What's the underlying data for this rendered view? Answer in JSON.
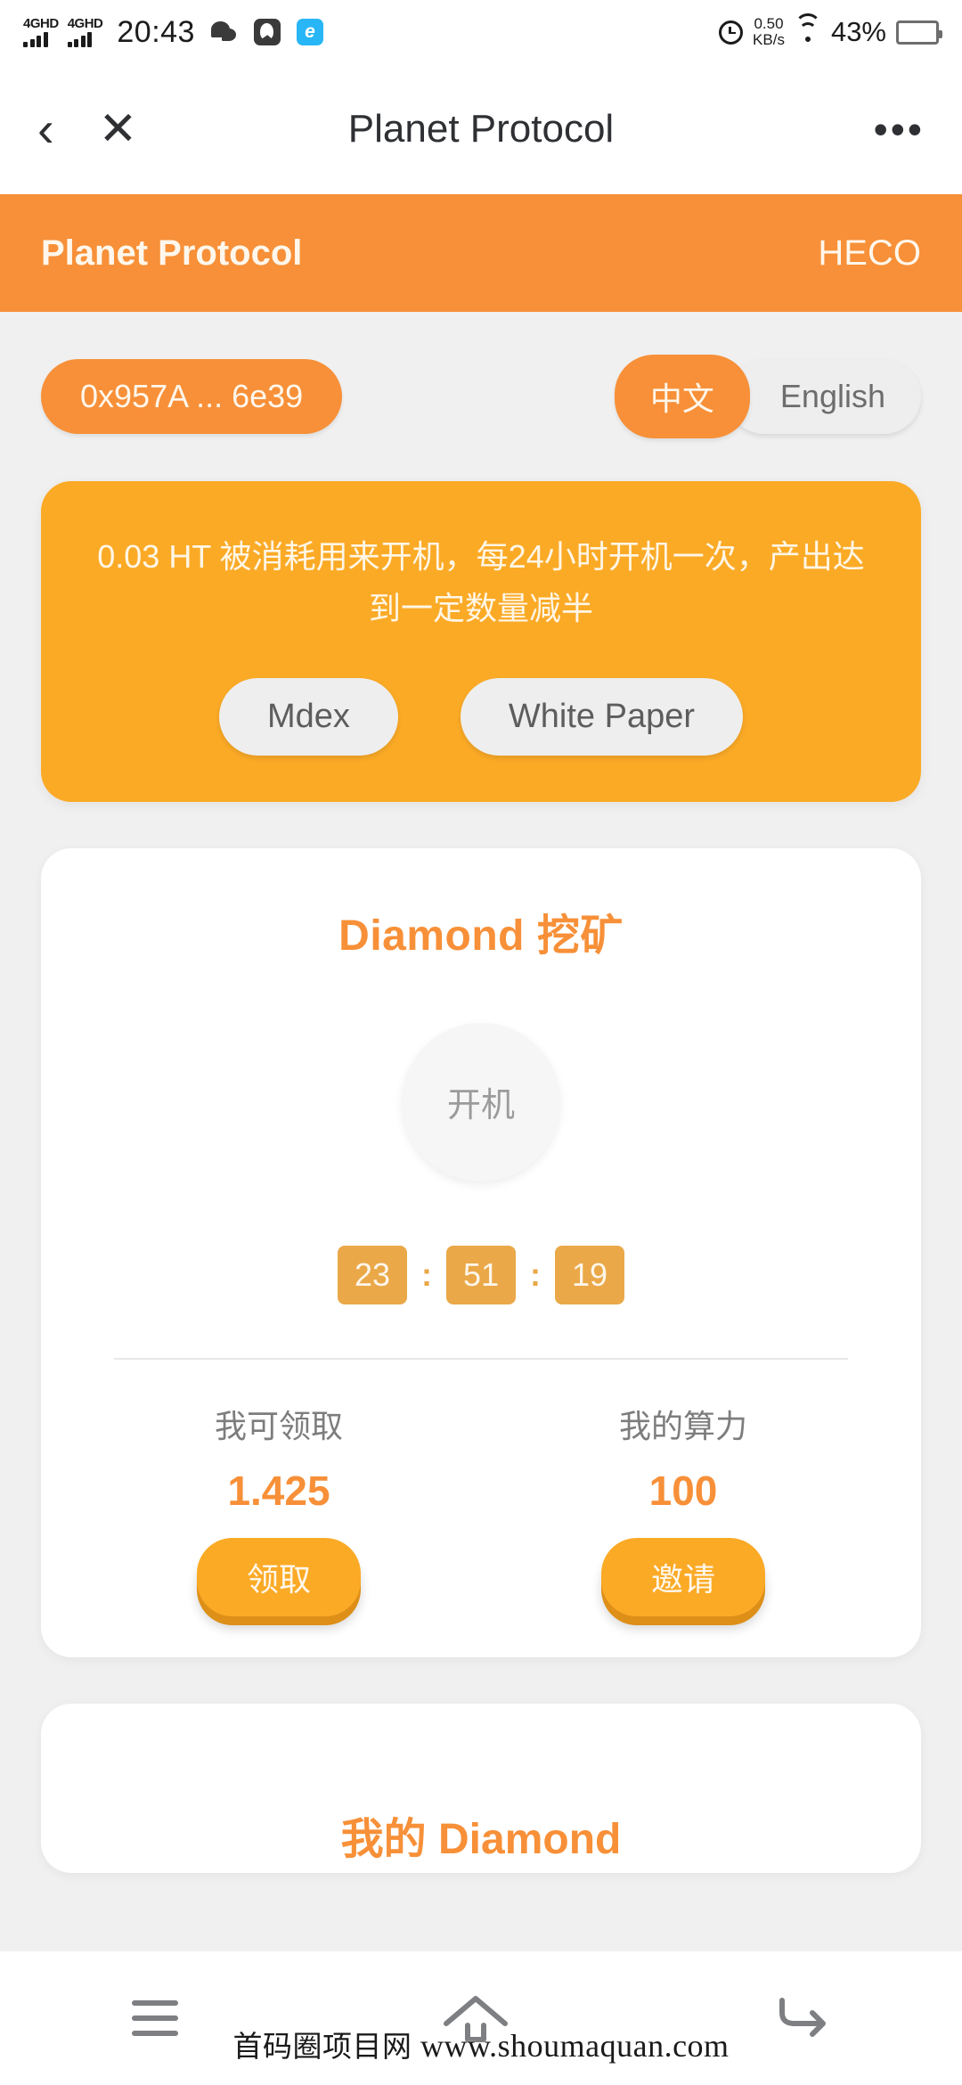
{
  "statusbar": {
    "network_labels": [
      "4GHD",
      "4GHD"
    ],
    "time": "20:43",
    "app_icons": [
      "wechat-icon",
      "dark-app-icon",
      "blue-e-app-icon"
    ],
    "alarm_icon": "alarm-icon",
    "net_speed_value": "0.50",
    "net_speed_unit": "KB/s",
    "wifi_icon": "wifi-icon",
    "battery_percent": "43%"
  },
  "navbar": {
    "back_icon": "‹",
    "close_icon": "✕",
    "title": "Planet Protocol",
    "more_icon": "•••"
  },
  "brandbar": {
    "name": "Planet Protocol",
    "network": "HECO",
    "bg_color": "#f79038"
  },
  "toprow": {
    "address": "0x957A ... 6e39",
    "languages": [
      {
        "label": "中文",
        "active": true
      },
      {
        "label": "English",
        "active": false
      }
    ]
  },
  "infocard": {
    "text": "0.03 HT 被消耗用来开机，每24小时开机一次，产出达到一定数量减半",
    "bg_color": "#fbaa26",
    "buttons": [
      {
        "label": "Mdex"
      },
      {
        "label": "White Paper"
      }
    ]
  },
  "minecard": {
    "title": "Diamond 挖矿",
    "title_color": "#f79038",
    "power_button_label": "开机",
    "timer": {
      "hours": "23",
      "minutes": "51",
      "seconds": "19",
      "separator": ":"
    },
    "stats": [
      {
        "label": "我可领取",
        "value": "1.425",
        "action": "领取"
      },
      {
        "label": "我的算力",
        "value": "100",
        "action": "邀请"
      }
    ]
  },
  "nextcard": {
    "title": "我的 Diamond"
  },
  "sysnav": {
    "items": [
      "menu-icon",
      "home-icon",
      "back-icon"
    ]
  },
  "watermark": {
    "cn": "首码圈项目网",
    "url": "www.shoumaquan.com"
  }
}
